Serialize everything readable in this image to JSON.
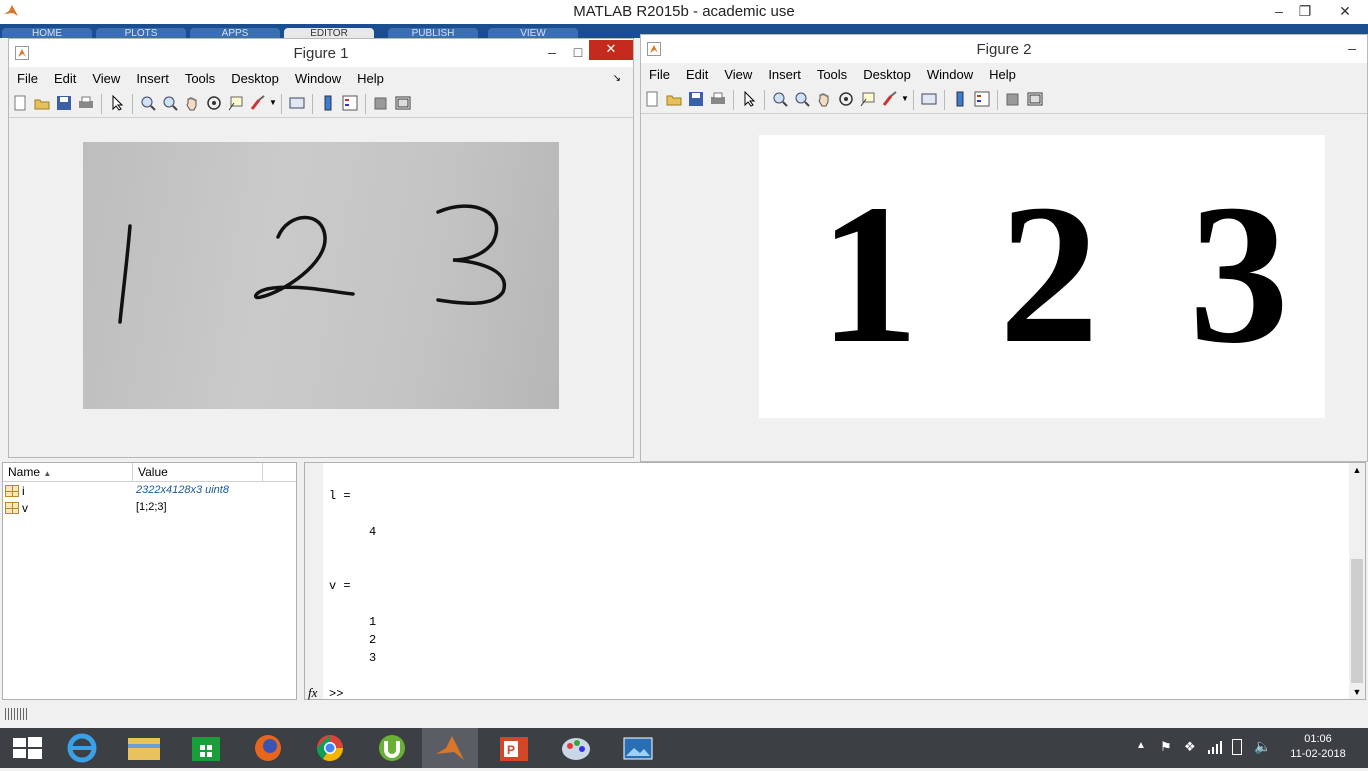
{
  "app": {
    "title": "MATLAB R2015b - academic use",
    "tabs": [
      "HOME",
      "PLOTS",
      "APPS",
      "EDITOR",
      "PUBLISH",
      "VIEW"
    ]
  },
  "figure1": {
    "title": "Figure 1",
    "menu": [
      "File",
      "Edit",
      "View",
      "Insert",
      "Tools",
      "Desktop",
      "Window",
      "Help"
    ],
    "handwritten": [
      "1",
      "2",
      "3"
    ]
  },
  "figure2": {
    "title": "Figure 2",
    "menu": [
      "File",
      "Edit",
      "View",
      "Insert",
      "Tools",
      "Desktop",
      "Window",
      "Help"
    ],
    "digits": [
      "1",
      "2",
      "3"
    ]
  },
  "workspace": {
    "col_name": "Name",
    "col_value": "Value",
    "rows": [
      {
        "name": "i",
        "value": "2322x4128x3 uint8"
      },
      {
        "name": "v",
        "value": "[1;2;3]"
      }
    ]
  },
  "command": {
    "var_l": "l =",
    "val_l": "4",
    "var_v": "v =",
    "vals_v": [
      "1",
      "2",
      "3"
    ],
    "fx": "fx",
    "prompt": ">>"
  },
  "taskbar": {
    "time": "01:06",
    "date": "11-02-2018"
  },
  "colors": {
    "toolstrip": "#1a4e8e",
    "close": "#c42b1c",
    "taskbar": "#3c3f44"
  }
}
